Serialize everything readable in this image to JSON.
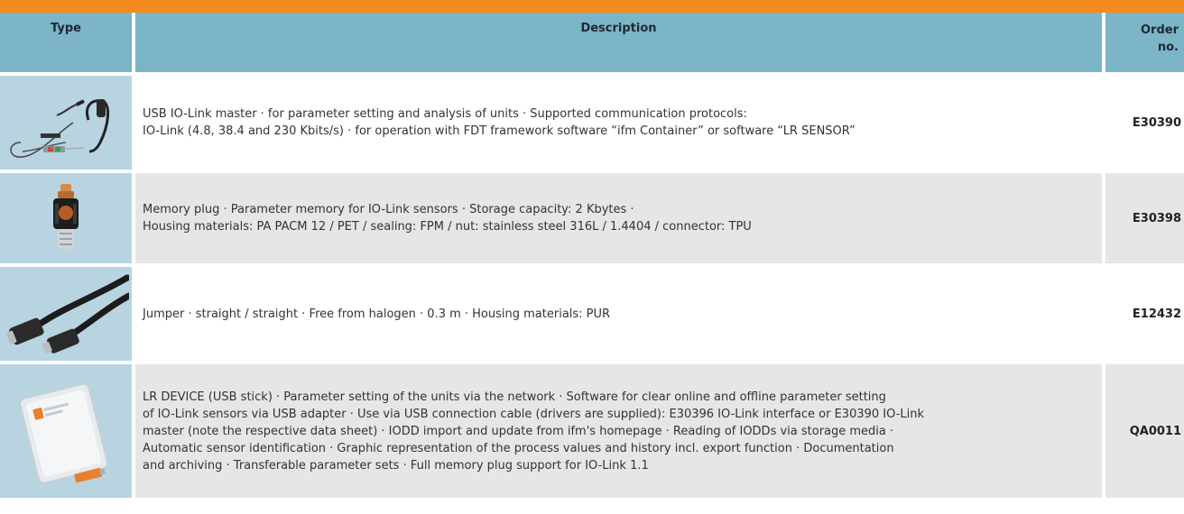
{
  "header": {
    "type_label": "Type",
    "description_label": "Description",
    "order_label_line1": "Order",
    "order_label_line2": "no."
  },
  "rows": [
    {
      "image": "usb-io-link-master-cable-image",
      "desc_lines": [
        "USB IO-Link master · for parameter setting and analysis of units · Supported communication protocols:",
        "IO-Link (4.8, 38.4 and 230 Kbits/s) · for operation with FDT framework software “ifm Container” or software “LR SENSOR”"
      ],
      "order": "E30390"
    },
    {
      "image": "memory-plug-image",
      "desc_lines": [
        "Memory plug · Parameter memory for IO-Link sensors · Storage capacity: 2 Kbytes ·",
        "Housing materials: PA PACM 12 / PET / sealing: FPM / nut: stainless steel 316L / 1.4404 / connector: TPU"
      ],
      "order": "E30398"
    },
    {
      "image": "jumper-cable-image",
      "desc_lines": [
        "Jumper · straight / straight · Free from halogen · 0.3 m · Housing materials: PUR"
      ],
      "order": "E12432"
    },
    {
      "image": "lr-device-usb-stick-image",
      "desc_lines": [
        "LR DEVICE (USB stick) · Parameter setting of the units via the network · Software for clear online and offline parameter setting",
        "of IO-Link sensors via USB adapter · Use via USB connection cable (drivers are supplied): E30396 IO-Link interface or E30390 IO-Link",
        "master (note the respective data sheet) · IODD import and update from ifm's homepage · Reading of IODDs via storage media ·",
        "Automatic sensor identification · Graphic representation of the process values and history incl. export function · Documentation",
        "and archiving · Transferable parameter sets · Full memory plug support for IO-Link 1.1"
      ],
      "order": "QA0011"
    }
  ]
}
